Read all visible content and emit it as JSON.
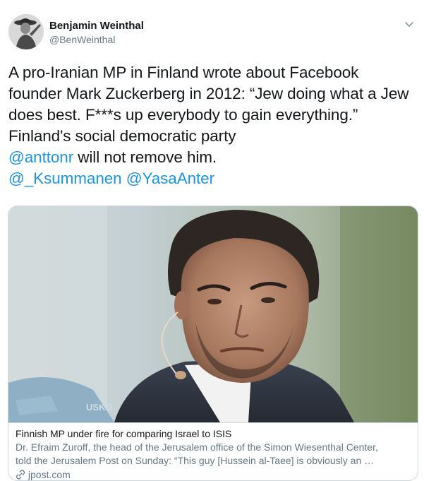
{
  "author": {
    "display_name": "Benjamin Weinthal",
    "handle": "@BenWeinthal",
    "avatar_icon": "person-with-hat-avatar"
  },
  "tweet": {
    "line1": "A pro-Iranian MP in Finland wrote about Facebook",
    "line2": "founder Mark Zuckerberg in 2012: “Jew doing what a Jew",
    "line3": "does best. F***s up everybody to gain everything.”",
    "line4": "Finland's social democratic party",
    "mention1": "@anttonr",
    "line5_rest": " will not remove him.",
    "mention2": "@_Ksummanen",
    "mention3": "@YasaAnter"
  },
  "card": {
    "title": "Finnish MP under fire for comparing Israel to ISIS",
    "desc_line1": "Dr. Efraim Zuroff, the head of the Jerusalem office of the Simon Wiesenthal Center,",
    "desc_line2": "told the Jerusalem Post on Sunday: “This guy [Hussein al-Taee] is obviously an …",
    "domain": "jpost.com",
    "image_text": "USKO"
  },
  "colors": {
    "link": "#1b95e0",
    "text": "#14171a",
    "secondary": "#657786",
    "border": "#ccd6dd"
  }
}
